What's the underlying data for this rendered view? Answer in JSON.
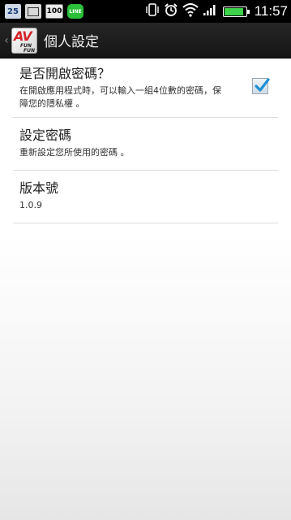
{
  "status_bar": {
    "icons": [
      {
        "name": "calendar-icon",
        "label": "25"
      },
      {
        "name": "mail-icon",
        "label": ""
      },
      {
        "name": "notification-100-icon",
        "label": "100"
      },
      {
        "name": "line-app-icon",
        "label": "LINE"
      }
    ],
    "right_icons": [
      "vibrate-icon",
      "alarm-clock-icon",
      "wifi-icon",
      "signal-icon",
      "battery-icon"
    ],
    "battery_level": 0.9,
    "time": "11:57"
  },
  "action_bar": {
    "logo": {
      "main": "AV",
      "sub1": "FUN",
      "sub2": "FUN"
    },
    "title": "個人設定"
  },
  "settings": [
    {
      "title": "是否開啟密碼？",
      "summary": "在開啟應用程式時，可以輸入一組4位數的密碼，保障您的隱私權 。",
      "checked": true
    },
    {
      "title": "設定密碼",
      "summary": "重新設定您所使用的密碼 。"
    },
    {
      "title": "版本號",
      "summary": "1.0.9"
    }
  ],
  "colors": {
    "status_bar_bg": "#000000",
    "action_bar_bg": "#1e1e1e",
    "checkbox_check": "#1e8fd2",
    "battery_fill": "#3cd24a",
    "logo_red": "#d4242a"
  }
}
